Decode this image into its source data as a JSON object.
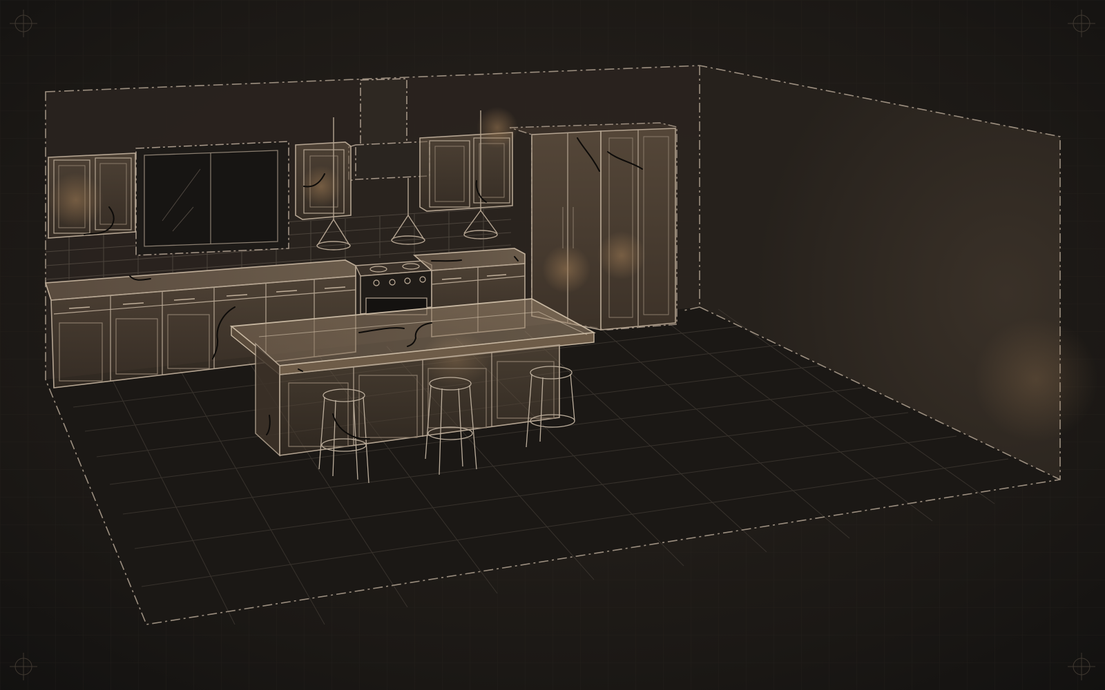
{
  "scene": {
    "subject": "kitchen-wireframe-render",
    "colors": {
      "background": "#1a1714",
      "line": "#a8998a",
      "line_faint": "#6f655a",
      "fill_warm": "#5c4e3e",
      "glow": "#8a6e4e",
      "sketch": "#0d0b09"
    },
    "icons": [
      "registration-mark-icon",
      "pendant-lamp-icon",
      "bar-stool-icon"
    ]
  }
}
